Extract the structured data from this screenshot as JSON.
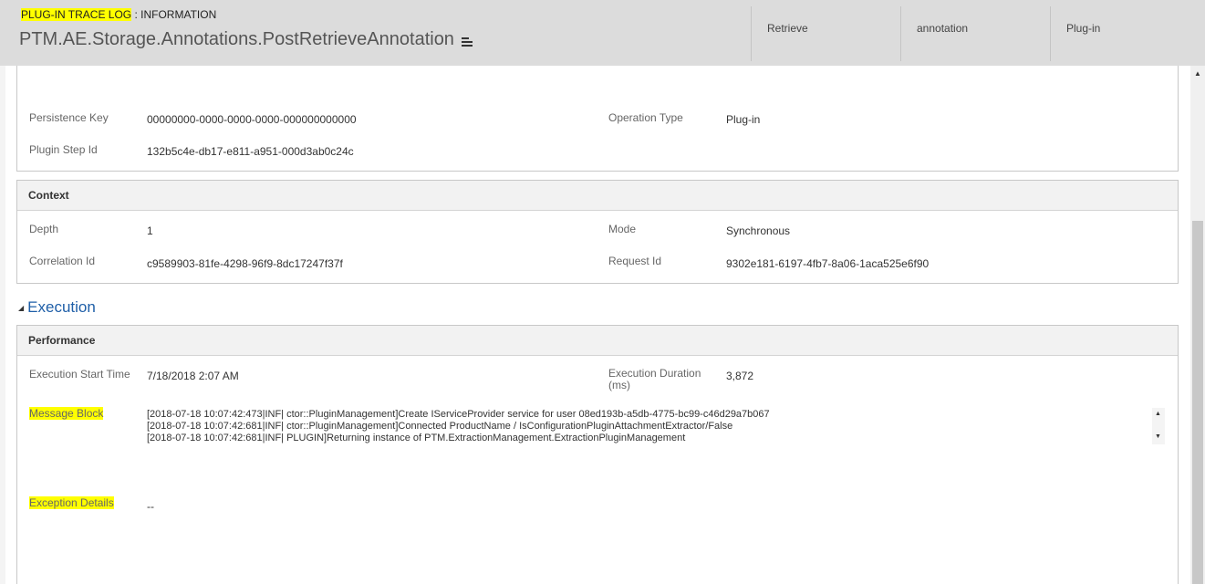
{
  "header": {
    "type_highlight": "PLUG-IN TRACE LOG",
    "type_rest": " : INFORMATION",
    "title": "PTM.AE.Storage.Annotations.PostRetrieveAnnotation",
    "fields": [
      "Retrieve",
      "annotation",
      "Plug-in"
    ]
  },
  "general": {
    "persistence_key_label": "Persistence Key",
    "persistence_key_value": "00000000-0000-0000-0000-000000000000",
    "operation_type_label": "Operation Type",
    "operation_type_value": "Plug-in",
    "plugin_step_label": "Plugin Step Id",
    "plugin_step_value": "132b5c4e-db17-e811-a951-000d3ab0c24c"
  },
  "context": {
    "title": "Context",
    "depth_label": "Depth",
    "depth_value": "1",
    "mode_label": "Mode",
    "mode_value": "Synchronous",
    "correlation_label": "Correlation Id",
    "correlation_value": "c9589903-81fe-4298-96f9-8dc17247f37f",
    "request_label": "Request Id",
    "request_value": "9302e181-6197-4fb7-8a06-1aca525e6f90"
  },
  "execution": {
    "heading": "Execution",
    "performance_title": "Performance",
    "start_time_label": "Execution Start Time",
    "start_time_value": "7/18/2018  2:07 AM",
    "duration_label": "Execution Duration (ms)",
    "duration_value": "3,872",
    "message_label": "Message Block",
    "message_value": "[2018-07-18 10:07:42:473|INF| ctor::PluginManagement]Create IServiceProvider service for user 08ed193b-a5db-4775-bc99-c46d29a7b067\n[2018-07-18 10:07:42:681|INF| ctor::PluginManagement]Connected ProductName / IsConfigurationPluginAttachmentExtractor/False\n[2018-07-18 10:07:42:681|INF| PLUGIN]Returning instance of PTM.ExtractionManagement.ExtractionPluginManagement",
    "exception_label": "Exception Details",
    "exception_value": "--"
  },
  "colors": {
    "highlight": "#ffff00",
    "link_blue": "#1f5fa8",
    "header_bg": "#dcdcdc"
  }
}
